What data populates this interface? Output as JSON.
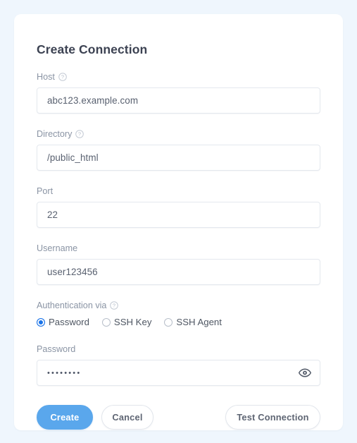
{
  "card": {
    "title": "Create Connection"
  },
  "fields": {
    "host": {
      "label": "Host",
      "value": "abc123.example.com",
      "help_icon": "help-circle-icon",
      "has_help": true
    },
    "directory": {
      "label": "Directory",
      "value": "/public_html",
      "help_icon": "help-circle-icon",
      "has_help": true
    },
    "port": {
      "label": "Port",
      "value": "22",
      "has_help": false
    },
    "username": {
      "label": "Username",
      "value": "user123456",
      "has_help": false
    },
    "password": {
      "label": "Password",
      "value": "••••••••",
      "has_help": false,
      "reveal_icon": "eye-icon"
    }
  },
  "auth": {
    "label": "Authentication via",
    "help_icon": "help-circle-icon",
    "selected": "Password",
    "options": [
      {
        "label": "Password",
        "checked": true
      },
      {
        "label": "SSH Key",
        "checked": false
      },
      {
        "label": "SSH Agent",
        "checked": false
      }
    ]
  },
  "buttons": {
    "create": "Create",
    "cancel": "Cancel",
    "test": "Test Connection"
  },
  "colors": {
    "page_background": "#eff6fd",
    "card_background": "#ffffff",
    "primary": "#5aa7ec",
    "radio_accent": "#1a73e8",
    "label": "#8a94a4",
    "value_text": "#596170",
    "title": "#3c4252",
    "border": "#e4e8ee"
  }
}
